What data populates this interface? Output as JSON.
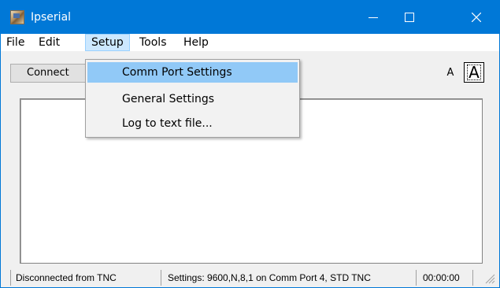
{
  "window": {
    "title": "Ipserial",
    "accent_color": "#0078d7",
    "controls": {
      "minimize_icon": "minimize-icon",
      "maximize_icon": "maximize-icon",
      "close_icon": "close-icon"
    }
  },
  "menubar": {
    "items": [
      "File",
      "Edit",
      "Setup",
      "Tools",
      "Help"
    ],
    "active": "Setup"
  },
  "setup_menu": {
    "items": [
      "Comm Port Settings",
      "General Settings",
      "Log to text file..."
    ],
    "highlighted": "Comm Port Settings",
    "highlight_color": "#91c9f7"
  },
  "toolbar": {
    "connect_label": "Connect",
    "font_small_label": "A",
    "font_large_label": "A"
  },
  "statusbar": {
    "connection": "Disconnected from TNC",
    "settings": "Settings: 9600,N,8,1 on Comm Port 4, STD TNC",
    "timer": "00:00:00"
  }
}
